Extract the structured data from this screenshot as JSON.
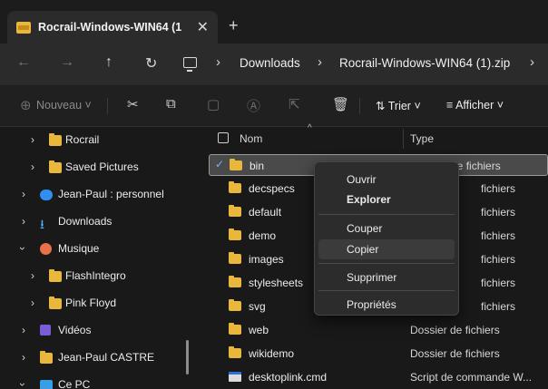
{
  "tab": {
    "title": "Rocrail-Windows-WIN64 (1",
    "close": "✕",
    "new": "+"
  },
  "address": {
    "back": "←",
    "forward": "→",
    "up": "↑",
    "refresh": "↻",
    "sep": "›",
    "crumbs": [
      "Downloads",
      "Rocrail-Windows-WIN64 (1).zip"
    ]
  },
  "commands": {
    "new_label": "Nouveau",
    "sort_label": "Trier",
    "view_label": "Afficher"
  },
  "nav": {
    "items": [
      {
        "label": "Rocrail",
        "icon": "folder-icon"
      },
      {
        "label": "Saved Pictures",
        "icon": "folder-icon"
      },
      {
        "label": "Jean-Paul : personnel",
        "icon": "cloud-icon"
      },
      {
        "label": "Downloads",
        "icon": "download-icon"
      },
      {
        "label": "Musique",
        "icon": "music-icon"
      },
      {
        "label": "FlashIntegro",
        "icon": "folder-icon"
      },
      {
        "label": "Pink Floyd",
        "icon": "folder-icon"
      },
      {
        "label": "Vidéos",
        "icon": "video-icon"
      },
      {
        "label": "Jean-Paul CASTRE",
        "icon": "folder-icon"
      },
      {
        "label": "Ce PC",
        "icon": "pc-icon"
      }
    ]
  },
  "list": {
    "header": {
      "name": "Nom",
      "type": "Type"
    },
    "rows": [
      {
        "name": "bin",
        "type": "Dossier de fichiers"
      },
      {
        "name": "decspecs",
        "type": "Dossier de fichiers"
      },
      {
        "name": "default",
        "type": "Dossier de fichiers"
      },
      {
        "name": "demo",
        "type": "Dossier de fichiers"
      },
      {
        "name": "images",
        "type": "Dossier de fichiers"
      },
      {
        "name": "stylesheets",
        "type": "Dossier de fichiers"
      },
      {
        "name": "svg",
        "type": "Dossier de fichiers"
      },
      {
        "name": "web",
        "type": "Dossier de fichiers"
      },
      {
        "name": "wikidemo",
        "type": "Dossier de fichiers"
      },
      {
        "name": "desktoplink.cmd",
        "type": "Script de commande W..."
      }
    ],
    "visible_types": [
      "Dossier de fichiers",
      "fichiers",
      "fichiers",
      "fichiers",
      "fichiers",
      "fichiers",
      "fichiers",
      "Dossier de fichiers",
      "Dossier de fichiers",
      "Script de commande W..."
    ]
  },
  "context_menu": {
    "open": "Ouvrir",
    "explore": "Explorer",
    "cut": "Couper",
    "copy": "Copier",
    "delete": "Supprimer",
    "properties": "Propriétés"
  },
  "colors": {
    "folder": "#e9b73b",
    "accent": "#6db6ff",
    "background": "#191919"
  }
}
